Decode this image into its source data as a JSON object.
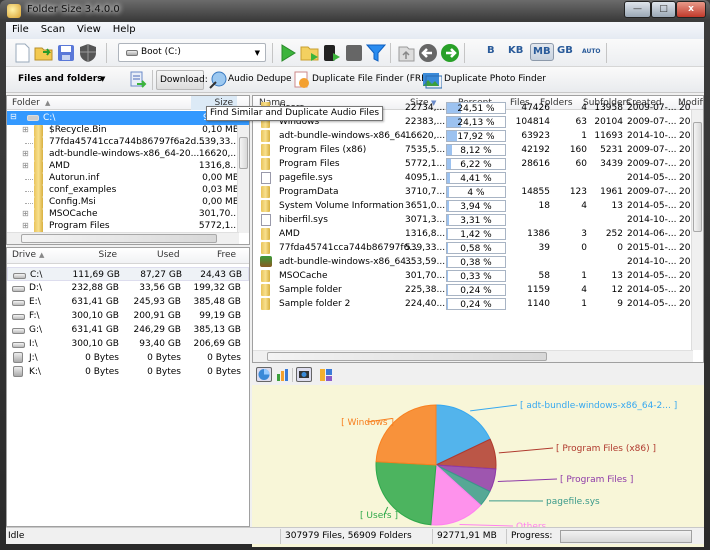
{
  "window": {
    "title": "Folder Size 3.4.0.0",
    "controls": {
      "minimize": "—",
      "maximize": "□",
      "close": "x"
    }
  },
  "menu": [
    "File",
    "Scan",
    "View",
    "Help"
  ],
  "toolbar": {
    "drive_select": {
      "value": "Boot (C:)"
    },
    "icons": [
      "new-icon",
      "open-icon",
      "save-icon",
      "shield-icon",
      "scan-play-icon",
      "scan-folder-icon",
      "scan-server-icon",
      "stop-icon",
      "filter-icon",
      "up-folder-icon",
      "back-icon",
      "forward-icon"
    ],
    "units": [
      "B",
      "KB",
      "MB",
      "GB",
      "AUTO"
    ],
    "active_unit": "MB"
  },
  "toolbar2": {
    "view_select": "Files and folders",
    "download_label": "Download:",
    "links": [
      "Audio Dedupe",
      "Duplicate File Finder (FREE)",
      "Duplicate Photo Finder"
    ]
  },
  "tooltip": "Find Similar and Duplicate Audio Files",
  "folder_tree": {
    "headers": {
      "folder": "Folder",
      "size": "Size"
    },
    "root": {
      "name": "C:\\",
      "size": "92..."
    },
    "items": [
      {
        "name": "$Recycle.Bin",
        "size": "0,10 MB",
        "expandable": true
      },
      {
        "name": "77fda45741cca744b86797f6a2d...",
        "size": "539,33...",
        "expandable": false
      },
      {
        "name": "adt-bundle-windows-x86_64-20...",
        "size": "16620,...",
        "expandable": true
      },
      {
        "name": "AMD",
        "size": "1316,8...",
        "expandable": true
      },
      {
        "name": "Autorun.inf",
        "size": "0,00 MB",
        "expandable": false
      },
      {
        "name": "conf_examples",
        "size": "0,03 MB",
        "expandable": false
      },
      {
        "name": "Config.Msi",
        "size": "0,00 MB",
        "expandable": false
      },
      {
        "name": "MSOCache",
        "size": "301,70...",
        "expandable": true
      },
      {
        "name": "Program Files",
        "size": "5772,1...",
        "expandable": true
      }
    ]
  },
  "drives": {
    "headers": {
      "drive": "Drive",
      "size": "Size",
      "used": "Used",
      "free": "Free"
    },
    "rows": [
      {
        "drive": "C:\\",
        "size": "111,69 GB",
        "used": "87,27 GB",
        "free": "24,43 GB",
        "type": "hdd"
      },
      {
        "drive": "D:\\",
        "size": "232,88 GB",
        "used": "33,56 GB",
        "free": "199,32 GB",
        "type": "hdd"
      },
      {
        "drive": "E:\\",
        "size": "631,41 GB",
        "used": "245,93 GB",
        "free": "385,48 GB",
        "type": "hdd"
      },
      {
        "drive": "F:\\",
        "size": "300,10 GB",
        "used": "200,91 GB",
        "free": "99,19 GB",
        "type": "hdd"
      },
      {
        "drive": "G:\\",
        "size": "631,41 GB",
        "used": "246,29 GB",
        "free": "385,13 GB",
        "type": "hdd"
      },
      {
        "drive": "I:\\",
        "size": "300,10 GB",
        "used": "93,40 GB",
        "free": "206,69 GB",
        "type": "hdd"
      },
      {
        "drive": "J:\\",
        "size": "0 Bytes",
        "used": "0 Bytes",
        "free": "0 Bytes",
        "type": "removable"
      },
      {
        "drive": "K:\\",
        "size": "0 Bytes",
        "used": "0 Bytes",
        "free": "0 Bytes",
        "type": "removable"
      }
    ]
  },
  "file_list": {
    "headers": [
      "Name",
      "Size",
      "Percent",
      "Files",
      "Folders",
      "Subfolders",
      "Created",
      "Modifi"
    ],
    "rows": [
      {
        "name": "Users",
        "size": "22734,...",
        "percent": 24.51,
        "percent_label": "24,51 %",
        "files": "47426",
        "folders": "4",
        "subfolders": "13958",
        "created": "2009-07-...",
        "modified": "20",
        "icon": "folder"
      },
      {
        "name": "Windows",
        "size": "22383,...",
        "percent": 24.13,
        "percent_label": "24,13 %",
        "files": "104814",
        "folders": "63",
        "subfolders": "20104",
        "created": "2009-07-...",
        "modified": "20",
        "icon": "folder"
      },
      {
        "name": "adt-bundle-windows-x86_64...",
        "size": "16620,...",
        "percent": 17.92,
        "percent_label": "17,92 %",
        "files": "63923",
        "folders": "1",
        "subfolders": "11693",
        "created": "2014-10-...",
        "modified": "20",
        "icon": "folder"
      },
      {
        "name": "Program Files (x86)",
        "size": "7535,5...",
        "percent": 8.12,
        "percent_label": "8,12 %",
        "files": "42192",
        "folders": "160",
        "subfolders": "5231",
        "created": "2009-07-...",
        "modified": "20",
        "icon": "folder"
      },
      {
        "name": "Program Files",
        "size": "5772,1...",
        "percent": 6.22,
        "percent_label": "6,22 %",
        "files": "28616",
        "folders": "60",
        "subfolders": "3439",
        "created": "2009-07-...",
        "modified": "20",
        "icon": "folder"
      },
      {
        "name": "pagefile.sys",
        "size": "4095,1...",
        "percent": 4.41,
        "percent_label": "4,41 %",
        "files": "",
        "folders": "",
        "subfolders": "",
        "created": "2014-05-...",
        "modified": "20",
        "icon": "file"
      },
      {
        "name": "ProgramData",
        "size": "3710,7...",
        "percent": 4,
        "percent_label": "4 %",
        "files": "14855",
        "folders": "123",
        "subfolders": "1961",
        "created": "2009-07-...",
        "modified": "20",
        "icon": "folder"
      },
      {
        "name": "System Volume Information",
        "size": "3651,0...",
        "percent": 3.94,
        "percent_label": "3,94 %",
        "files": "18",
        "folders": "4",
        "subfolders": "13",
        "created": "2014-05-...",
        "modified": "20",
        "icon": "folder"
      },
      {
        "name": "hiberfil.sys",
        "size": "3071,3...",
        "percent": 3.31,
        "percent_label": "3,31 %",
        "files": "",
        "folders": "",
        "subfolders": "",
        "created": "2014-10-...",
        "modified": "20",
        "icon": "file"
      },
      {
        "name": "AMD",
        "size": "1316,8...",
        "percent": 1.42,
        "percent_label": "1,42 %",
        "files": "1386",
        "folders": "3",
        "subfolders": "252",
        "created": "2014-06-...",
        "modified": "20",
        "icon": "folder"
      },
      {
        "name": "77fda45741cca744b86797f6...",
        "size": "539,33...",
        "percent": 0.58,
        "percent_label": "0,58 %",
        "files": "39",
        "folders": "0",
        "subfolders": "0",
        "created": "2015-01-...",
        "modified": "20",
        "icon": "folder"
      },
      {
        "name": "adt-bundle-windows-x86_64...",
        "size": "353,59...",
        "percent": 0.38,
        "percent_label": "0,38 %",
        "files": "",
        "folders": "",
        "subfolders": "",
        "created": "2014-10-...",
        "modified": "20",
        "icon": "archive"
      },
      {
        "name": "MSOCache",
        "size": "301,70...",
        "percent": 0.33,
        "percent_label": "0,33 %",
        "files": "58",
        "folders": "1",
        "subfolders": "13",
        "created": "2014-05-...",
        "modified": "20",
        "icon": "folder"
      },
      {
        "name": "Sample folder",
        "size": "225,38...",
        "percent": 0.24,
        "percent_label": "0,24 %",
        "files": "1159",
        "folders": "4",
        "subfolders": "12",
        "created": "2014-05-...",
        "modified": "20",
        "icon": "folder"
      },
      {
        "name": "Sample folder 2",
        "size": "224,40...",
        "percent": 0.24,
        "percent_label": "0,24 %",
        "files": "1140",
        "folders": "1",
        "subfolders": "9",
        "created": "2014-05-...",
        "modified": "20",
        "icon": "folder"
      }
    ]
  },
  "chart_data": {
    "type": "pie",
    "title": "",
    "slices": [
      {
        "label": "[ adt-bundle-windows-x86_64-2... ]",
        "value": 17.92,
        "color": "#36a8f0"
      },
      {
        "label": "[ Program Files (x86) ]",
        "value": 8.12,
        "color": "#b03a2e"
      },
      {
        "label": "[ Program Files ]",
        "value": 6.22,
        "color": "#8e3aa8"
      },
      {
        "label": "pagefile.sys",
        "value": 4.41,
        "color": "#3a9a8a"
      },
      {
        "label": "Others",
        "value": 14.69,
        "color": "#ff80f0"
      },
      {
        "label": "[ Users ]",
        "value": 24.51,
        "color": "#2ea84a"
      },
      {
        "label": "[ Windows ]",
        "value": 24.13,
        "color": "#f88020"
      }
    ]
  },
  "status": {
    "state": "Idle",
    "counts": "307979 Files, 56909 Folders",
    "total": "92771,91 MB",
    "progress_label": "Progress:",
    "progress": 0
  }
}
